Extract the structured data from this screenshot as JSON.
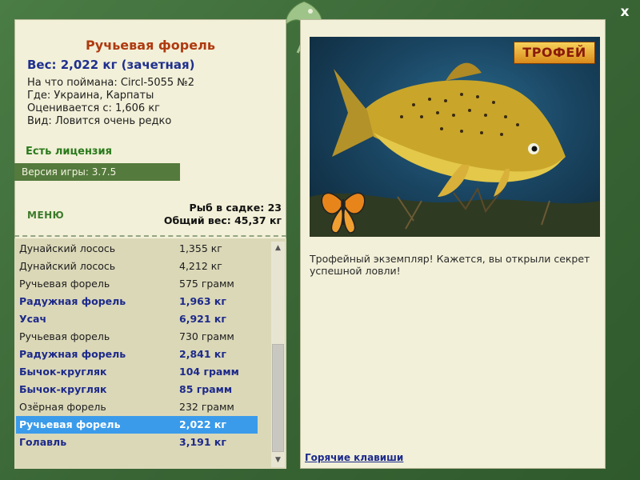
{
  "trophy": {
    "fish_name": "Ручьевая форель",
    "weight": "Вес: 2,022 кг (зачетная)",
    "bait": "На что поймана: Circl-5055 №2",
    "location": "Где: Украина, Карпаты",
    "rated_from": "Оценивается с: 1,606 кг",
    "kind": "Вид: Ловится очень редко"
  },
  "license": "Есть лицензия",
  "version": "Версия игры: 3.7.5",
  "menu_label": "МЕНЮ",
  "stats": {
    "fish_count": "Рыб в садке: 23",
    "total_weight": "Общий вес: 45,37 кг"
  },
  "catch_list": [
    {
      "name": "Дунайский лосось",
      "weight": "1,355 кг",
      "bold": false,
      "selected": false
    },
    {
      "name": "Дунайский лосось",
      "weight": "4,212 кг",
      "bold": false,
      "selected": false
    },
    {
      "name": "Ручьевая форель",
      "weight": "575 грамм",
      "bold": false,
      "selected": false
    },
    {
      "name": "Радужная форель",
      "weight": "1,963 кг",
      "bold": true,
      "selected": false
    },
    {
      "name": "Усач",
      "weight": "6,921 кг",
      "bold": true,
      "selected": false
    },
    {
      "name": "Ручьевая форель",
      "weight": "730 грамм",
      "bold": false,
      "selected": false
    },
    {
      "name": "Радужная форель",
      "weight": "2,841 кг",
      "bold": true,
      "selected": false
    },
    {
      "name": "Бычок-кругляк",
      "weight": "104 грамм",
      "bold": true,
      "selected": false
    },
    {
      "name": "Бычок-кругляк",
      "weight": "85 грамм",
      "bold": true,
      "selected": false
    },
    {
      "name": "Озёрная форель",
      "weight": "232 грамм",
      "bold": false,
      "selected": false
    },
    {
      "name": "Ручьевая форель",
      "weight": "2,022 кг",
      "bold": true,
      "selected": true
    },
    {
      "name": "Голавль",
      "weight": "3,191 кг",
      "bold": true,
      "selected": false
    }
  ],
  "photo_badge": "ТРОФЕЙ",
  "description": "Трофейный экземпляр! Кажется, вы открыли секрет успешной ловли!",
  "hotkeys_link": "Горячие клавиши",
  "close_label": "x",
  "colors": {
    "frame": "#3f6e3a",
    "panel": "#f2f0d8",
    "selection": "#3a9bea",
    "title_red": "#b03a10",
    "bold_blue": "#1d2a8a"
  }
}
